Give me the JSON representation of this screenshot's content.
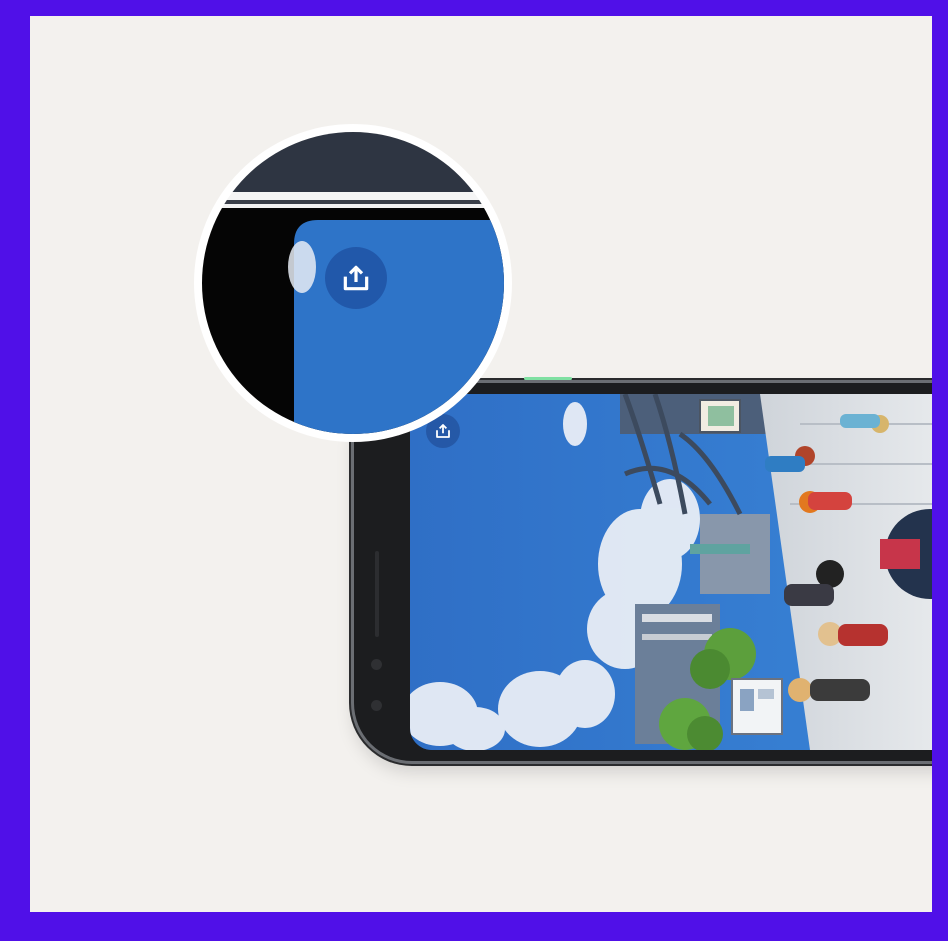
{
  "scene": {
    "background_border_color": "#5010E8",
    "canvas_color": "#F3F1EE",
    "phone_body_color": "#1c1d1f",
    "screen_sky_color": "#2E74C8",
    "accent_highlight_color": "#7fe0a2"
  },
  "icons": {
    "share_button_icon": "share-upload-icon",
    "magnified_share_button_icon": "share-upload-icon"
  }
}
